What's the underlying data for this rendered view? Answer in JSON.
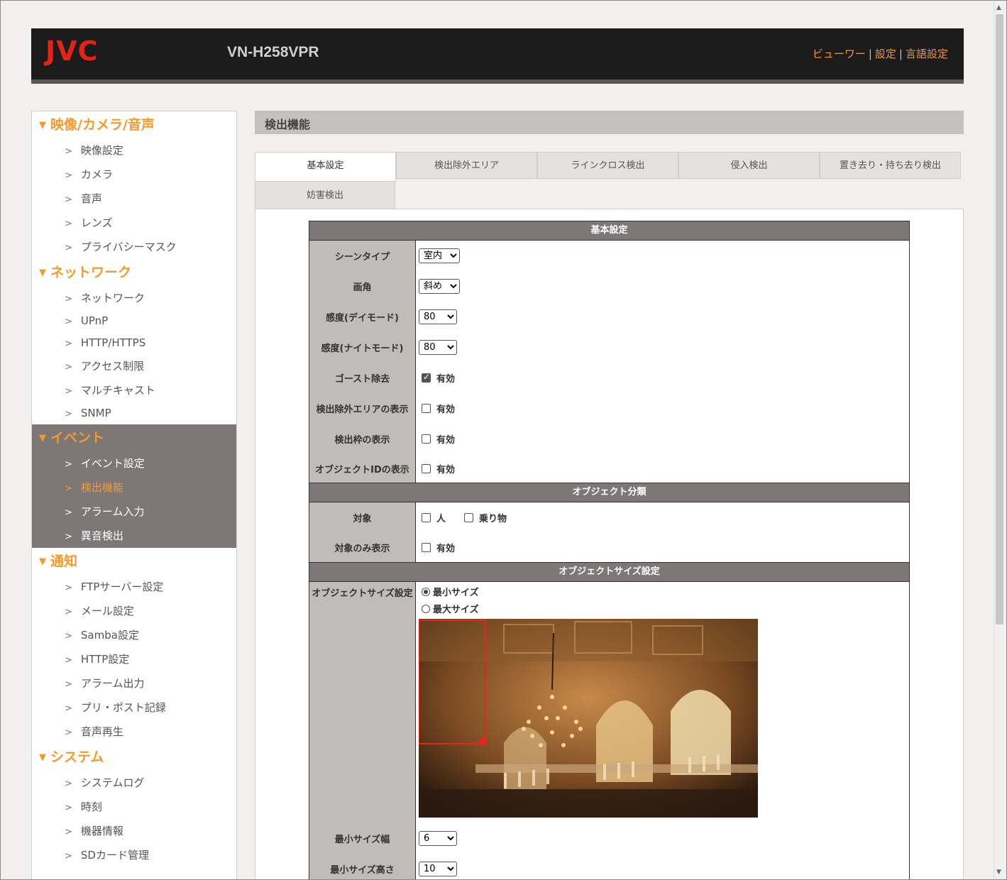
{
  "header": {
    "logo": "JVC",
    "model": "VN-H258VPR",
    "links": [
      "ビューワー",
      "設定",
      "言語設定"
    ],
    "separator": "|"
  },
  "sidebar": {
    "sections": [
      {
        "title": "映像/カメラ/音声",
        "items": [
          "映像設定",
          "カメラ",
          "音声",
          "レンズ",
          "プライバシーマスク"
        ]
      },
      {
        "title": "ネットワーク",
        "items": [
          "ネットワーク",
          "UPnP",
          "HTTP/HTTPS",
          "アクセス制限",
          "マルチキャスト",
          "SNMP"
        ]
      },
      {
        "title": "イベント",
        "items": [
          "イベント設定",
          "検出機能",
          "アラーム入力",
          "異音検出"
        ]
      },
      {
        "title": "通知",
        "items": [
          "FTPサーバー設定",
          "メール設定",
          "Samba設定",
          "HTTP設定",
          "アラーム出力",
          "プリ・ポスト記録",
          "音声再生"
        ]
      },
      {
        "title": "システム",
        "items": [
          "システムログ",
          "時刻",
          "機器情報",
          "SDカード管理"
        ]
      }
    ],
    "active_item": "検出機能",
    "chevron": ">",
    "triangle": "▼"
  },
  "page": {
    "title": "検出機能",
    "tabs": [
      "基本設定",
      "検出除外エリア",
      "ラインクロス検出",
      "侵入検出",
      "置き去り・持ち去り検出",
      "妨害検出"
    ],
    "active_tab": "基本設定"
  },
  "basic": {
    "header": "基本設定",
    "scene_type": {
      "label": "シーンタイプ",
      "value": "室内"
    },
    "view_angle": {
      "label": "画角",
      "value": "斜め"
    },
    "sens_day": {
      "label": "感度(デイモード)",
      "value": "80"
    },
    "sens_night": {
      "label": "感度(ナイトモード)",
      "value": "80"
    },
    "ghost": {
      "label": "ゴースト除去",
      "option": "有効",
      "checked": true
    },
    "exclude_area": {
      "label": "検出除外エリアの表示",
      "option": "有効",
      "checked": false
    },
    "frame": {
      "label": "検出枠の表示",
      "option": "有効",
      "checked": false
    },
    "object_id": {
      "label": "オブジェクトIDの表示",
      "option": "有効",
      "checked": false
    }
  },
  "classify": {
    "header": "オブジェクト分類",
    "target": {
      "label": "対象",
      "opt1": "人",
      "opt2": "乗り物"
    },
    "only": {
      "label": "対象のみ表示",
      "option": "有効"
    }
  },
  "size": {
    "header": "オブジェクトサイズ設定",
    "label": "オブジェクトサイズ設定",
    "radio_min": "最小サイズ",
    "radio_max": "最大サイズ",
    "min_width": {
      "label": "最小サイズ幅",
      "value": "6"
    },
    "min_height": {
      "label": "最小サイズ高さ",
      "value": "10"
    }
  },
  "colors": {
    "accent": "#f39a2c",
    "header_bg": "#1c1b1b",
    "active_bg": "#7d7778",
    "logo": "#e2231a"
  }
}
